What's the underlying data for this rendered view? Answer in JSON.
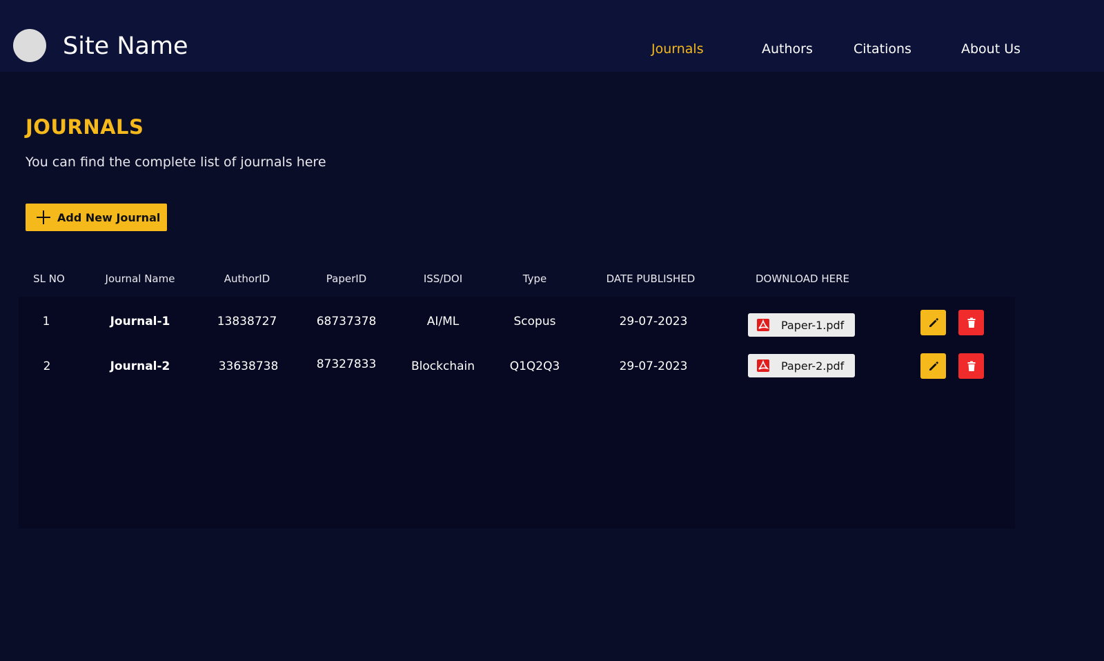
{
  "header": {
    "site_name": "Site Name",
    "nav": [
      {
        "label": "Journals",
        "active": true
      },
      {
        "label": "Authors",
        "active": false
      },
      {
        "label": "Citations",
        "active": false
      },
      {
        "label": "About Us",
        "active": false
      }
    ]
  },
  "page": {
    "title": "JOURNALS",
    "subtitle": "You can find the complete list of journals here",
    "add_button_label": "Add New  Journal"
  },
  "table": {
    "headers": [
      "SL NO",
      "Journal Name",
      "AuthorID",
      "PaperID",
      "ISS/DOI",
      "Type",
      "DATE PUBLISHED",
      "DOWNLOAD HERE"
    ],
    "rows": [
      {
        "sl": "1",
        "name": "Journal-1",
        "author_id": "13838727",
        "paper_id": "68737378",
        "iss_doi": "AI/ML",
        "type": "Scopus",
        "date": "29-07-2023",
        "file": "Paper-1.pdf"
      },
      {
        "sl": "2",
        "name": "Journal-2",
        "author_id": "33638738",
        "paper_id": "87327833",
        "iss_doi": "Blockchain",
        "type": "Q1Q2Q3",
        "date": "29-07-2023",
        "file": "Paper-2.pdf"
      }
    ]
  },
  "icons": {
    "logo": "circle-logo",
    "add": "plus-icon",
    "pdf": "pdf-file-icon",
    "edit": "pencil-icon",
    "delete": "trash-icon"
  },
  "colors": {
    "background": "#0a0d28",
    "header": "#0c1238",
    "accent": "#f6b91c",
    "danger": "#ef2b2b",
    "table_body": "#060921"
  }
}
